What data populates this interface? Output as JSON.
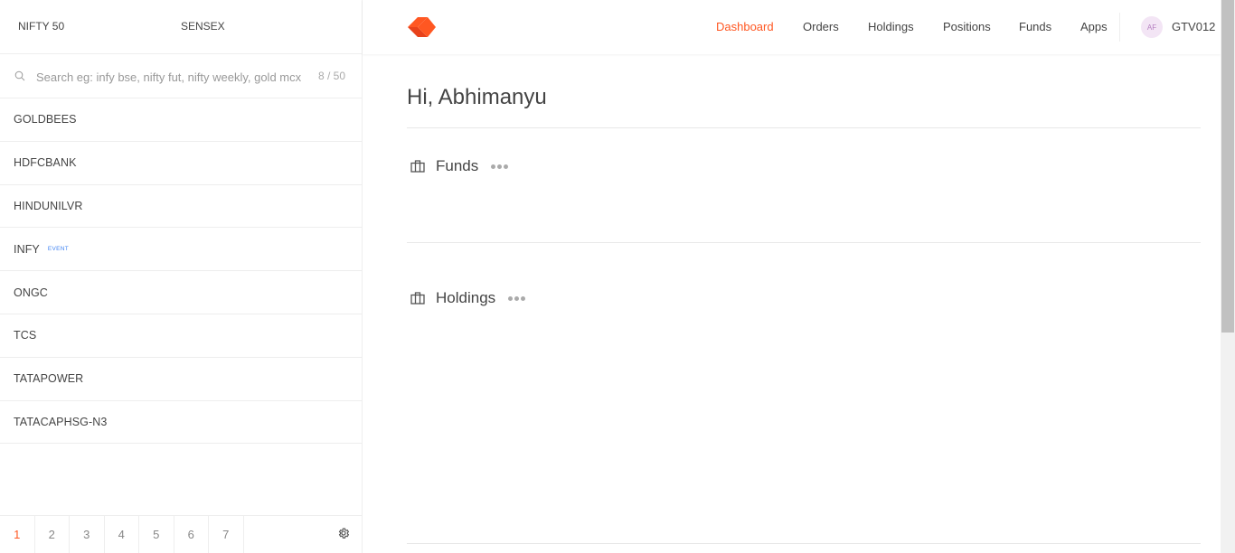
{
  "indices": [
    "NIFTY 50",
    "SENSEX"
  ],
  "search": {
    "placeholder": "Search eg: infy bse, nifty fut, nifty weekly, gold mcx",
    "count": "8 / 50"
  },
  "watchlist": [
    {
      "symbol": "GOLDBEES",
      "badge": ""
    },
    {
      "symbol": "HDFCBANK",
      "badge": ""
    },
    {
      "symbol": "HINDUNILVR",
      "badge": ""
    },
    {
      "symbol": "INFY",
      "badge": "EVENT"
    },
    {
      "symbol": "ONGC",
      "badge": ""
    },
    {
      "symbol": "TCS",
      "badge": ""
    },
    {
      "symbol": "TATAPOWER",
      "badge": ""
    },
    {
      "symbol": "TATACAPHSG-N3",
      "badge": ""
    }
  ],
  "pages": [
    "1",
    "2",
    "3",
    "4",
    "5",
    "6",
    "7"
  ],
  "active_page": "1",
  "nav": [
    "Dashboard",
    "Orders",
    "Holdings",
    "Positions",
    "Funds",
    "Apps"
  ],
  "active_nav": "Dashboard",
  "user": {
    "initials": "AF",
    "id": "GTV012"
  },
  "main": {
    "greeting": "Hi, Abhimanyu",
    "sections": [
      "Funds",
      "Holdings"
    ]
  },
  "colors": {
    "accent": "#ff5722",
    "badge": "#4184f3",
    "avatar_bg": "#f3e5f5"
  },
  "icons": {
    "search": "search-icon",
    "settings": "gear-icon",
    "section": "briefcase-icon",
    "loading": "loading-dots-icon"
  }
}
